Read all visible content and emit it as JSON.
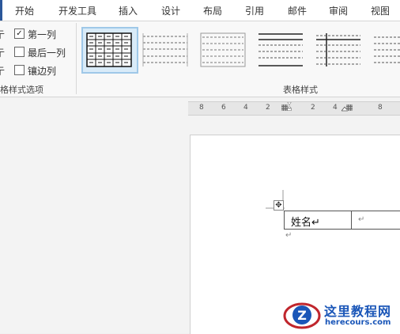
{
  "ribbon_tabs": [
    {
      "label": "开始"
    },
    {
      "label": "开发工具"
    },
    {
      "label": "插入"
    },
    {
      "label": "设计"
    },
    {
      "label": "布局"
    },
    {
      "label": "引用"
    },
    {
      "label": "邮件"
    },
    {
      "label": "审阅"
    },
    {
      "label": "视图"
    }
  ],
  "style_options": {
    "left_cut_glyph": "亍",
    "items": [
      {
        "label": "第一列",
        "checked": true,
        "mark": "✓"
      },
      {
        "label": "最后一列",
        "checked": false,
        "mark": ""
      },
      {
        "label": "镶边列",
        "checked": false,
        "mark": ""
      }
    ],
    "group_label": "格样式选项"
  },
  "table_styles": {
    "group_label": "表格样式",
    "selected_index": 0,
    "selected_border_color": "#9fc8e8"
  },
  "ruler": {
    "ticks": [
      "8",
      "6",
      "4",
      "2",
      "2",
      "4",
      "8"
    ]
  },
  "document": {
    "table_move_glyph": "✥",
    "cells": [
      {
        "text": "姓名↵"
      },
      {
        "text": "↵"
      }
    ],
    "paragraph_mark": "↵"
  },
  "watermark": {
    "title": "这里教程网",
    "url": "herecours.com",
    "logo_letter": "Z",
    "colors": {
      "blue": "#1a56b8",
      "red": "#c0262d"
    }
  }
}
